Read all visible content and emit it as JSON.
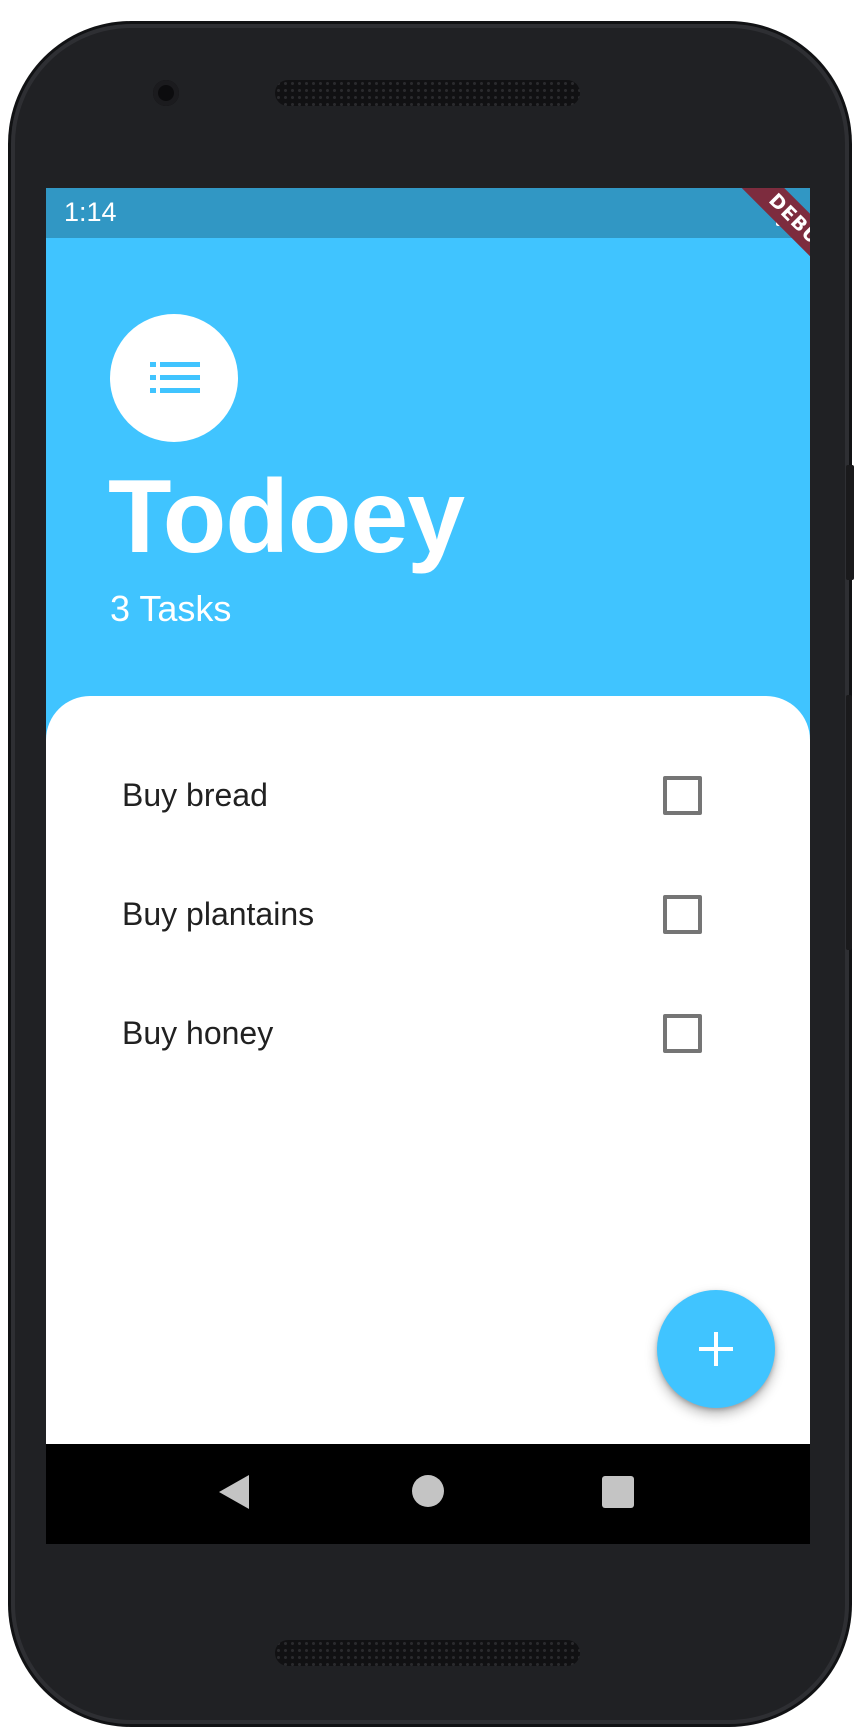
{
  "status_bar": {
    "time": "1:14",
    "battery_icon": "battery-full-icon"
  },
  "debug_banner": {
    "label": "DEBUG",
    "color": "#7d2c3e"
  },
  "header": {
    "icon": "list-icon",
    "title": "Todoey",
    "subtitle": "3 Tasks"
  },
  "tasks": [
    {
      "label": "Buy bread",
      "checked": false
    },
    {
      "label": "Buy plantains",
      "checked": false
    },
    {
      "label": "Buy honey",
      "checked": false
    }
  ],
  "fab": {
    "icon": "plus-icon"
  },
  "nav_bar": {
    "back_icon": "back-triangle-icon",
    "home_icon": "home-circle-icon",
    "recents_icon": "recents-square-icon"
  },
  "colors": {
    "accent": "#40c4ff",
    "status_bar": "#3197c4",
    "panel": "#ffffff",
    "checkbox_border": "#757575"
  }
}
